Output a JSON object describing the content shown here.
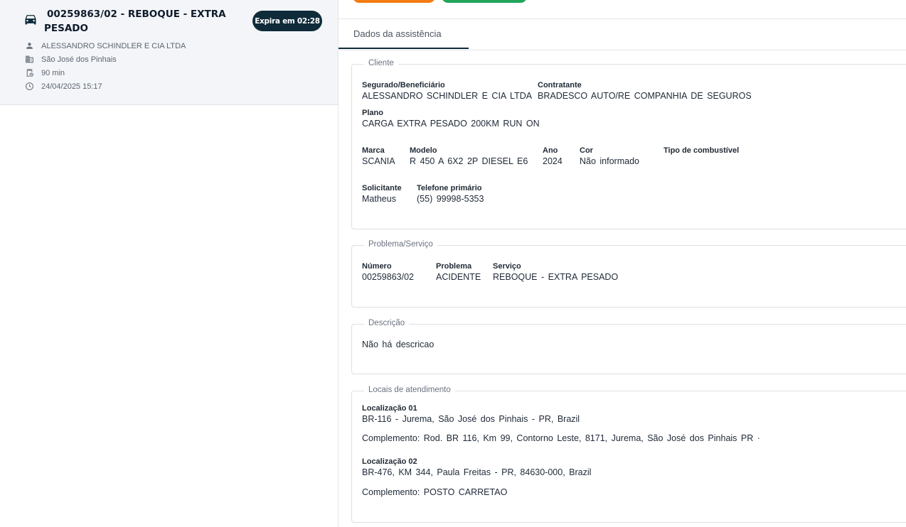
{
  "card": {
    "title": "00259863/02 - REBOQUE - EXTRA PESADO",
    "expire": "Expira em 02:28",
    "client": "ALESSANDRO SCHINDLER E CIA LTDA",
    "city": "São José dos Pinhais",
    "duration": "90 min",
    "datetime": "24/04/2025 15:17"
  },
  "tabs": {
    "active": "Dados da assistência"
  },
  "cliente": {
    "legend": "Cliente",
    "segurado_label": "Segurado/Beneficiário",
    "segurado": "ALESSANDRO SCHINDLER E CIA LTDA",
    "contratante_label": "Contratante",
    "contratante": "BRADESCO AUTO/RE COMPANHIA DE SEGUROS",
    "plano_label": "Plano",
    "plano": "CARGA EXTRA PESADO 200KM RUN ON",
    "marca_label": "Marca",
    "marca": "SCANIA",
    "modelo_label": "Modelo",
    "modelo": "R 450 A 6X2 2P DIESEL E6",
    "ano_label": "Ano",
    "ano": "2024",
    "cor_label": "Cor",
    "cor": "Não informado",
    "combustivel_label": "Tipo de combustível",
    "solicitante_label": "Solicitante",
    "solicitante": "Matheus",
    "telefone_label": "Telefone primário",
    "telefone": "(55) 99998-5353"
  },
  "problema": {
    "legend": "Problema/Serviço",
    "numero_label": "Número",
    "numero": "00259863/02",
    "problema_label": "Problema",
    "problema": "ACIDENTE",
    "servico_label": "Serviço",
    "servico": "REBOQUE - EXTRA PESADO"
  },
  "descricao": {
    "legend": "Descrição",
    "text": "Não há descricao"
  },
  "locais": {
    "legend": "Locais de atendimento",
    "items": [
      {
        "label": "Localização 01",
        "address": "BR-116 - Jurema, São José dos Pinhais - PR, Brazil",
        "complemento": "Complemento: Rod. BR 116, Km 99, Contorno Leste, 8171, Jurema, São José dos Pinhais PR ·"
      },
      {
        "label": "Localização 02",
        "address": "BR-476, KM 344, Paula Freitas - PR, 84630-000, Brazil",
        "complemento": "Complemento: POSTO CARRETAO"
      }
    ]
  },
  "colors": {
    "dark": "#0f2b3a",
    "orange": "#f37c13",
    "green": "#22a55b",
    "card_bg": "#f3f5f8"
  }
}
